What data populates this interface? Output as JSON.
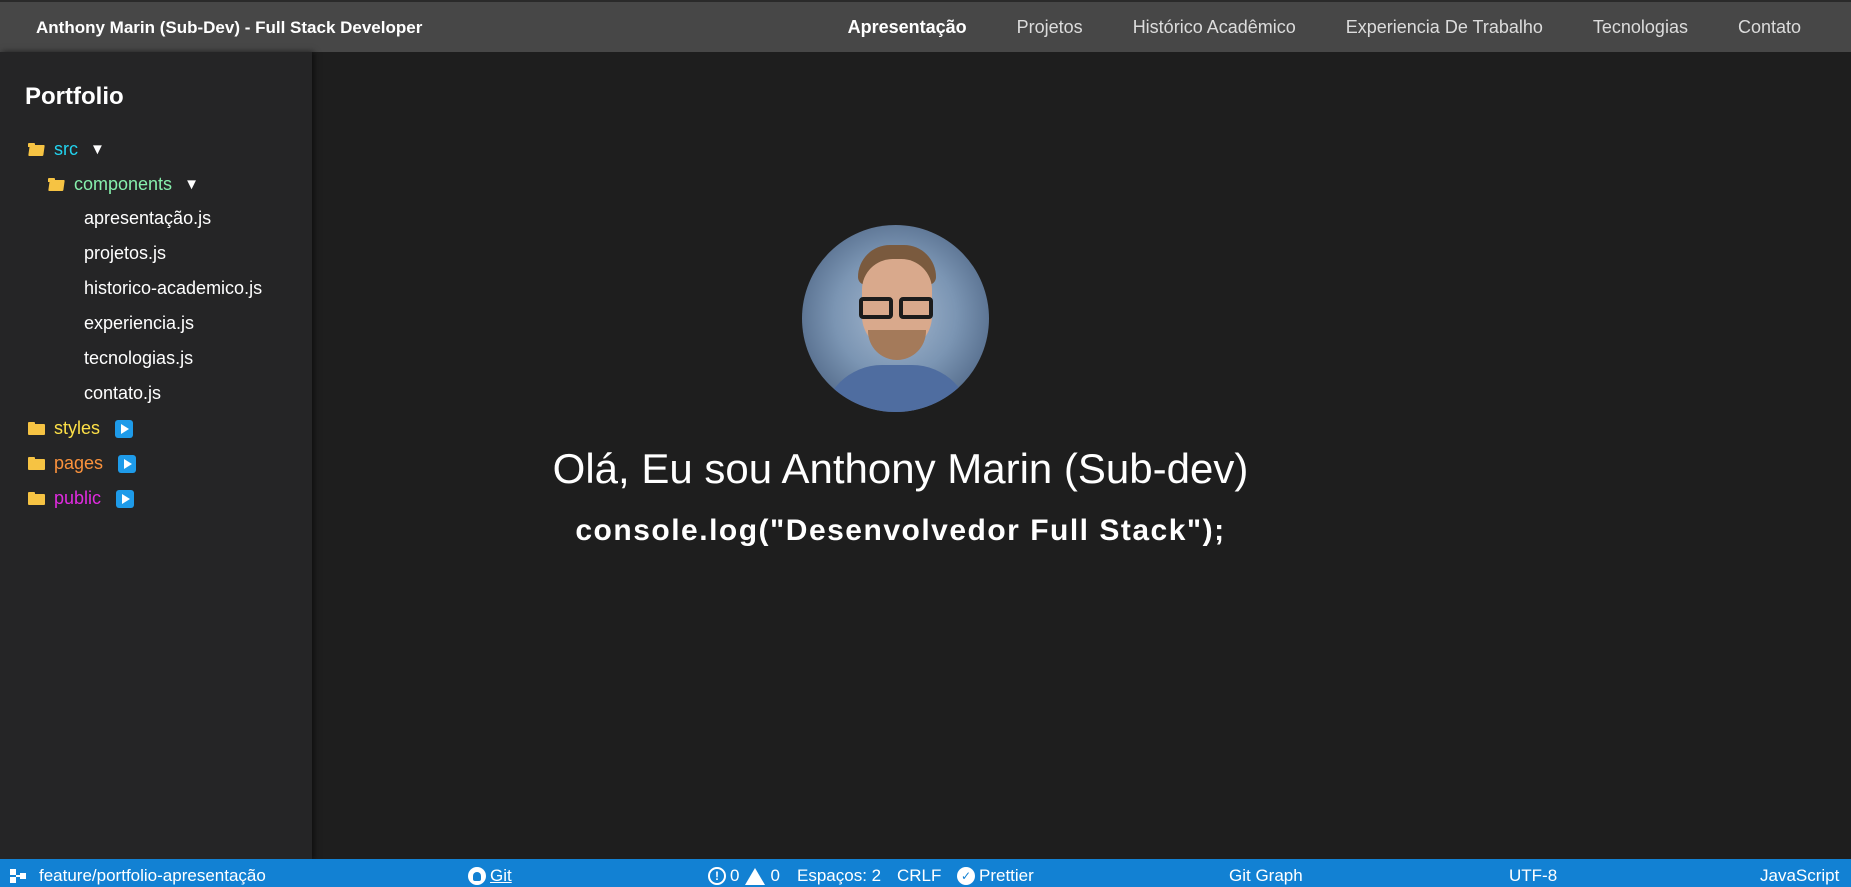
{
  "header": {
    "brand": "Anthony Marin (Sub-Dev) - Full Stack Developer",
    "nav": [
      {
        "label": "Apresentação"
      },
      {
        "label": "Projetos"
      },
      {
        "label": "Histórico Acadêmico"
      },
      {
        "label": "Experiencia De Trabalho"
      },
      {
        "label": "Tecnologias"
      },
      {
        "label": "Contato"
      }
    ]
  },
  "sidebar": {
    "title": "Portfolio",
    "src": {
      "label": "src",
      "color": "#22d3ee",
      "expand_icon": "▼"
    },
    "components": {
      "label": "components",
      "color": "#86efac",
      "expand_icon": "▼"
    },
    "files": [
      {
        "label": "apresentação.js"
      },
      {
        "label": "projetos.js"
      },
      {
        "label": "historico-academico.js"
      },
      {
        "label": "experiencia.js"
      },
      {
        "label": "tecnologias.js"
      },
      {
        "label": "contato.js"
      }
    ],
    "folders": [
      {
        "label": "styles",
        "color": "#fde047",
        "icon": "play-icon"
      },
      {
        "label": "pages",
        "color": "#fb923c",
        "icon": "play-icon"
      },
      {
        "label": "public",
        "color": "#e12be0",
        "icon": "play-icon"
      }
    ]
  },
  "main": {
    "greeting": "Olá, Eu sou Anthony Marin (Sub-dev)",
    "console_line": "console.log(\"Desenvolvedor Full Stack\");"
  },
  "statusbar": {
    "branch": "feature/portfolio-apresentação",
    "git": "Git",
    "errors": "0",
    "warnings": "0",
    "spaces": "Espaços: 2",
    "eol": "CRLF",
    "prettier": "Prettier",
    "git_graph": "Git Graph",
    "encoding": "UTF-8",
    "language": "JavaScript"
  }
}
